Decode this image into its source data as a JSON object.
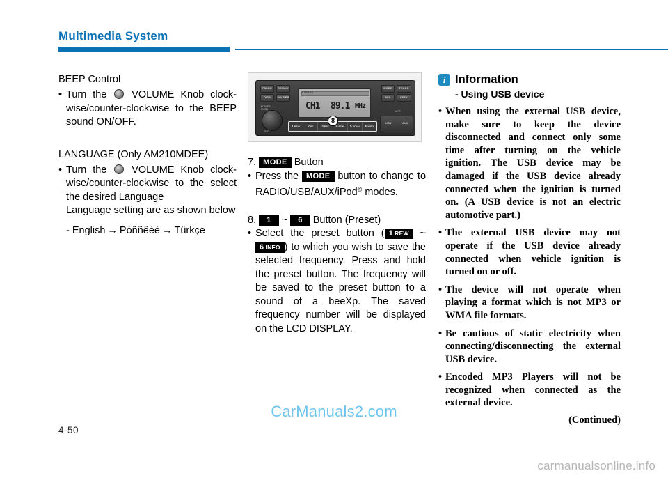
{
  "header": {
    "title": "Multimedia System",
    "accent_color": "#0b72b5"
  },
  "left_column": {
    "beep": {
      "heading": "BEEP Control",
      "bullet": "Turn the",
      "bullet_after_knob": "VOLUME Knob clock-wise/counter-clockwise to the BEEP sound ON/OFF.",
      "knob_icon": "volume-knob-icon"
    },
    "language": {
      "heading": "LANGUAGE (Only AM210MDEE)",
      "bullet": "Turn the",
      "bullet_after_knob": "VOLUME Knob clock-wise/counter-clockwise to the select the desired Language",
      "note": "Language setting are   as shown below",
      "list_prefix": "- ",
      "languages": [
        "English",
        "Póññêèé",
        "Türkçe"
      ],
      "arrow": "→"
    }
  },
  "figure": {
    "name": "car-audio-head-unit",
    "left_buttons": [
      {
        "label": "FM/AM"
      },
      {
        "label": "CD/AUX"
      },
      {
        "label": "DISP"
      },
      {
        "label": "FOLDER"
      }
    ],
    "power_label": "POWER",
    "power_sub": "PUSH",
    "knob_label": "VOL",
    "lcd": {
      "tag": "STEREO",
      "channel": "CH1",
      "frequency": "89.1",
      "unit": "MHz"
    },
    "presets": [
      {
        "num": "1",
        "sub": "REW"
      },
      {
        "num": "2",
        "sub": "FF"
      },
      {
        "num": "3",
        "sub": "RPT"
      },
      {
        "num": "4",
        "sub": "RDM"
      },
      {
        "num": "5",
        "sub": "SCAN"
      },
      {
        "num": "6",
        "sub": "INFO"
      }
    ],
    "callout": "8",
    "right_buttons": [
      {
        "label": "MODE"
      },
      {
        "label": "TRACK"
      },
      {
        "label": "SEL"
      },
      {
        "label": "SEEK"
      }
    ],
    "mp3_label": "MP3",
    "ports": [
      {
        "label": "USB"
      },
      {
        "label": "AUX"
      }
    ]
  },
  "middle_column": {
    "item7": {
      "number": "7.",
      "key": "MODE",
      "suffix": "Button",
      "bullet_pre": "Press the",
      "bullet_key": "MODE",
      "bullet_post": "button to change to RADIO/USB/AUX/iPod",
      "bullet_reg": "®",
      "bullet_end": " modes."
    },
    "item8": {
      "number": "8.",
      "key_from": "1",
      "tilde": "~",
      "key_to": "6",
      "suffix": "Button (Preset)",
      "bullet_pre": "Select the preset button (",
      "key_from_full_num": "1",
      "key_from_full_sub": "REW",
      "mid_tilde": "~",
      "key_to_full_num": "6",
      "key_to_full_sub": "INFO",
      "bullet_post": ") to which you wish to save the selected frequency. Press and hold the preset button. The frequency will be saved to the preset button to a sound of a beeXp. The saved frequency number will be displayed on the LCD DISPLAY."
    }
  },
  "right_column": {
    "icon": "information-icon",
    "title": "Information",
    "subtitle": "- Using USB device",
    "bullets": [
      "When using the external USB device, make sure to keep the device disconnected and connect only some time after turning on the vehicle ignition. The USB device may be damaged if the USB device already connected when the ignition is turned on. (A USB device is not an electric automotive part.)",
      "The external USB device may not operate if the USB device already connected when vehicle ignition is turned on or off.",
      "The device will not operate when playing a format which is not MP3 or WMA file formats.",
      "Be cautious of static electricity when connecting/disconnecting the external USB device.",
      "Encoded MP3 Players will not be recognized when connected as the external device."
    ],
    "continued": "(Continued)"
  },
  "footer": {
    "page_number": "4-50",
    "watermark_main": "CarManuals2.com",
    "watermark_bottom": "carmanualsonline.info"
  }
}
